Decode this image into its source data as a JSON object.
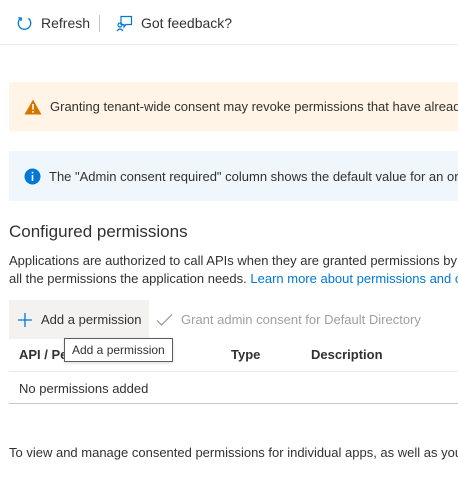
{
  "toolbar": {
    "refresh_label": "Refresh",
    "feedback_label": "Got feedback?"
  },
  "banners": {
    "warning_text": "Granting tenant-wide consent may revoke permissions that have already been",
    "info_text": "The \"Admin consent required\" column shows the default value for an organiz"
  },
  "section": {
    "title": "Configured permissions",
    "description_line1": "Applications are authorized to call APIs when they are granted permissions by",
    "description_line2_prefix": "all the permissions the application needs. ",
    "learn_more_link": "Learn more about permissions and c"
  },
  "commands": {
    "add_permission_label": "Add a permission",
    "grant_consent_label": "Grant admin consent for Default Directory"
  },
  "table": {
    "columns": {
      "api": "API / Pe",
      "type": "Type",
      "description": "Description"
    },
    "empty_message": "No permissions added"
  },
  "tooltip": {
    "text": "Add a permission"
  },
  "footer": {
    "text": "To view and manage consented permissions for individual apps, as well as your"
  },
  "colors": {
    "accent": "#0078d4",
    "warning_bg": "#fff4e5",
    "warning_icon": "#d47500",
    "info_bg": "#eff6fc",
    "info_icon": "#0078d4",
    "disabled_text": "#a19f9d"
  },
  "icons": {
    "refresh": "refresh-icon",
    "feedback": "feedback-icon",
    "warning": "warning-icon",
    "info": "info-icon",
    "add": "plus-icon",
    "grant": "checkmark-icon"
  }
}
